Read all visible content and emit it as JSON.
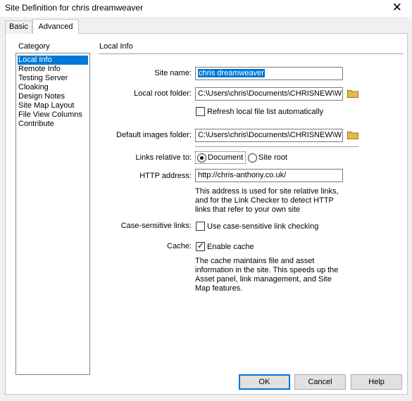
{
  "window": {
    "title": "Site Definition for chris dreamweaver",
    "close_glyph": "✕"
  },
  "tabs": [
    {
      "label": "Basic"
    },
    {
      "label": "Advanced",
      "active": true
    }
  ],
  "category": {
    "label": "Category",
    "items": [
      {
        "label": "Local Info",
        "selected": true
      },
      {
        "label": "Remote Info"
      },
      {
        "label": "Testing Server"
      },
      {
        "label": "Cloaking"
      },
      {
        "label": "Design Notes"
      },
      {
        "label": "Site Map Layout"
      },
      {
        "label": "File View Columns"
      },
      {
        "label": "Contribute"
      }
    ]
  },
  "section": {
    "title": "Local Info"
  },
  "form": {
    "site_name": {
      "label": "Site name:",
      "value": "chris dreamweaver"
    },
    "local_root": {
      "label": "Local root folder:",
      "value": "C:\\Users\\chris\\Documents\\CHRISNEW\\WE",
      "icon": "folder-icon"
    },
    "refresh": {
      "label": "Refresh local file list automatically",
      "checked": false
    },
    "default_images": {
      "label": "Default images folder:",
      "value": "C:\\Users\\chris\\Documents\\CHRISNEW\\WE",
      "icon": "folder-icon"
    },
    "links_relative": {
      "label": "Links relative to:",
      "option_document": "Document",
      "option_site_root": "Site root",
      "selected": "Document"
    },
    "http_address": {
      "label": "HTTP address:",
      "value": "http://chris-anthony.co.uk/",
      "note": "This address is used for site relative links, and for the Link Checker to detect HTTP links that refer to your own site"
    },
    "case_sensitive": {
      "label": "Case-sensitive links:",
      "checkbox_label": "Use case-sensitive link checking",
      "checked": false
    },
    "cache": {
      "label": "Cache:",
      "checkbox_label": "Enable cache",
      "checked": true,
      "note": "The cache maintains file and asset information in the site.  This speeds up the Asset panel, link management, and Site Map features."
    }
  },
  "buttons": {
    "ok": "OK",
    "cancel": "Cancel",
    "help": "Help"
  },
  "colors": {
    "selection": "#0078d7",
    "folder": "#e8b84a"
  }
}
